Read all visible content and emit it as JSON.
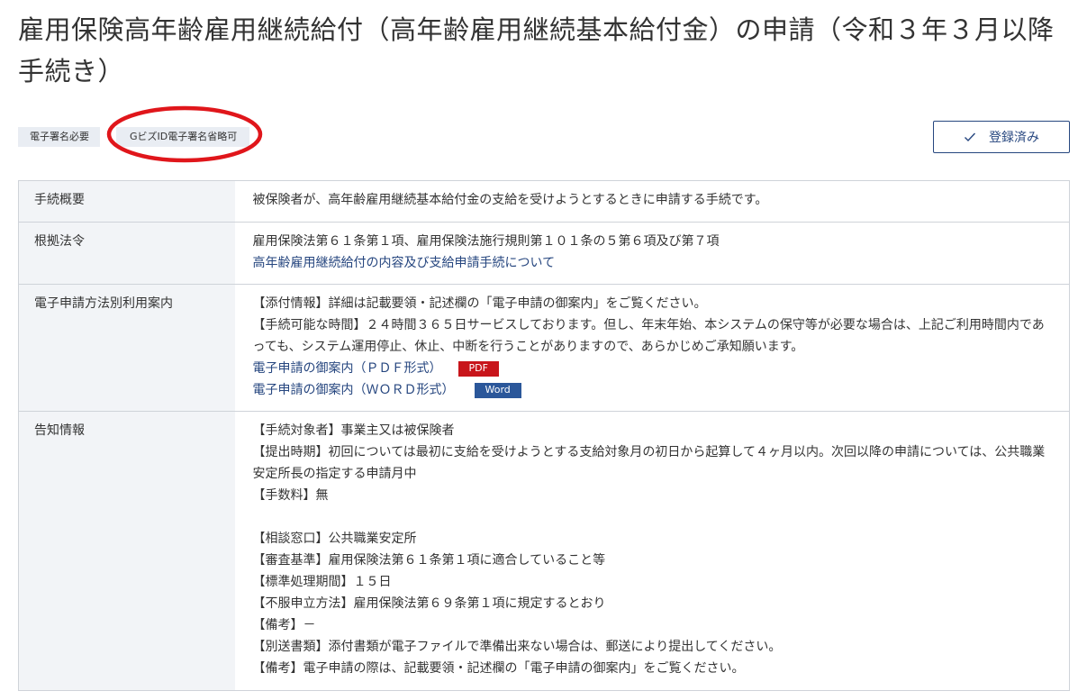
{
  "page": {
    "title": "雇用保険高年齢雇用継続給付（高年齢雇用継続基本給付金）の申請（令和３年３月以降手続き）"
  },
  "tags": [
    {
      "label": "電子署名必要"
    },
    {
      "label": "GビズID電子署名省略可"
    }
  ],
  "actions": {
    "registered_label": "登録済み"
  },
  "colors": {
    "accent": "#26467f",
    "annotation": "#e0161b",
    "pdf_badge": "#c8151b",
    "word_badge": "#2b579a",
    "label_bg": "#f2f4f7"
  },
  "rows": {
    "overview": {
      "label": "手続概要",
      "text": "被保険者が、高年齢雇用継続基本給付金の支給を受けようとするときに申請する手続です。"
    },
    "law": {
      "label": "根拠法令",
      "text": "雇用保険法第６１条第１項、雇用保険法施行規則第１０１条の５第６項及び第７項",
      "link": "高年齢雇用継続給付の内容及び支給申請手続について"
    },
    "method": {
      "label": "電子申請方法別利用案内",
      "line1": "【添付情報】詳細は記載要領・記述欄の「電子申請の御案内」をご覧ください。",
      "line2": "【手続可能な時間】２４時間３６５日サービスしております。但し、年末年始、本システムの保守等が必要な場合は、上記ご利用時間内であっても、システム運用停止、休止、中断を行うことがありますので、あらかじめご承知願います。",
      "pdf_link": "電子申請の御案内（ＰＤＦ形式）",
      "pdf_badge": "PDF",
      "word_link": "電子申請の御案内（ＷＯＲＤ形式）",
      "word_badge": "Word"
    },
    "notice": {
      "label": "告知情報",
      "lines": [
        "【手続対象者】事業主又は被保険者",
        "【提出時期】初回については最初に支給を受けようとする支給対象月の初日から起算して４ヶ月以内。次回以降の申請については、公共職業安定所長の指定する申請月中",
        "【手数料】無",
        "【相談窓口】公共職業安定所",
        "【審査基準】雇用保険法第６１条第１項に適合していること等",
        "【標準処理期間】１５日",
        "【不服申立方法】雇用保険法第６９条第１項に規定するとおり",
        "【備考】－",
        "【別送書類】添付書類が電子ファイルで準備出来ない場合は、郵送により提出してください。",
        "【備考】電子申請の際は、記載要領・記述欄の「電子申請の御案内」をご覧ください。"
      ]
    }
  }
}
